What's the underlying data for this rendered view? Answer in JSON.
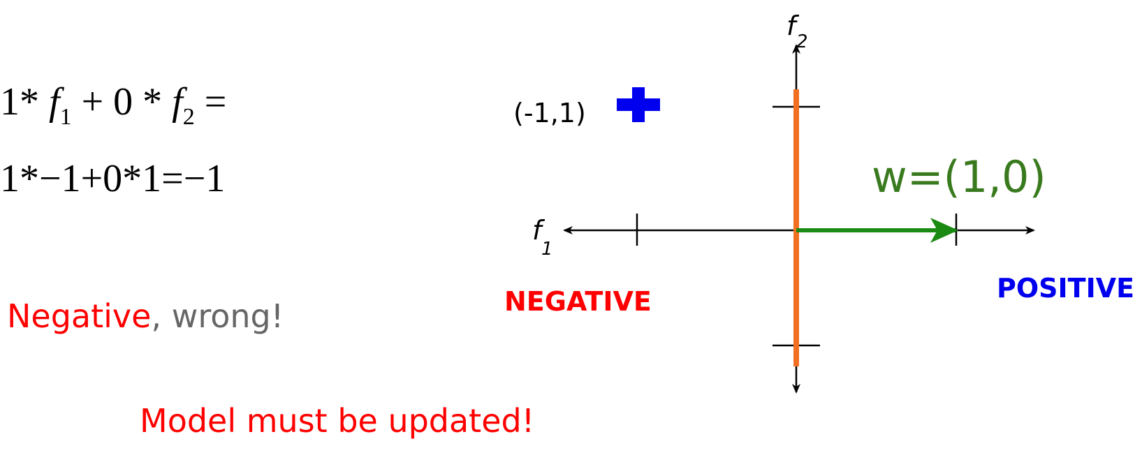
{
  "equations": {
    "line1": {
      "c1": "1",
      "op1": "*",
      "var1": "f",
      "sub1": "1",
      "plus": "+",
      "c2": "0",
      "op2": "*",
      "var2": "f",
      "sub2": "2",
      "equals": "="
    },
    "line2": "1*−1+0*1=−1"
  },
  "verdict": {
    "negative": "Negative",
    "comma": ",",
    "wrong": " wrong!"
  },
  "update_message": "Model must be updated!",
  "diagram": {
    "point_label": "(-1,1)",
    "point_marker": "plus",
    "weight_label": "w=(1,0)",
    "negative_label": "NEGATIVE",
    "positive_label": "POSITIVE",
    "x_axis": {
      "name": "f",
      "sub": "1"
    },
    "y_axis": {
      "name": "f",
      "sub": "2"
    },
    "colors": {
      "weight_vector": "#1a8a12",
      "weight_label": "#3a7a1e",
      "decision_boundary": "#f07020",
      "positive": "#0000ee",
      "negative": "#ff0000",
      "point_marker": "#0000ee",
      "axes": "#000000"
    }
  }
}
